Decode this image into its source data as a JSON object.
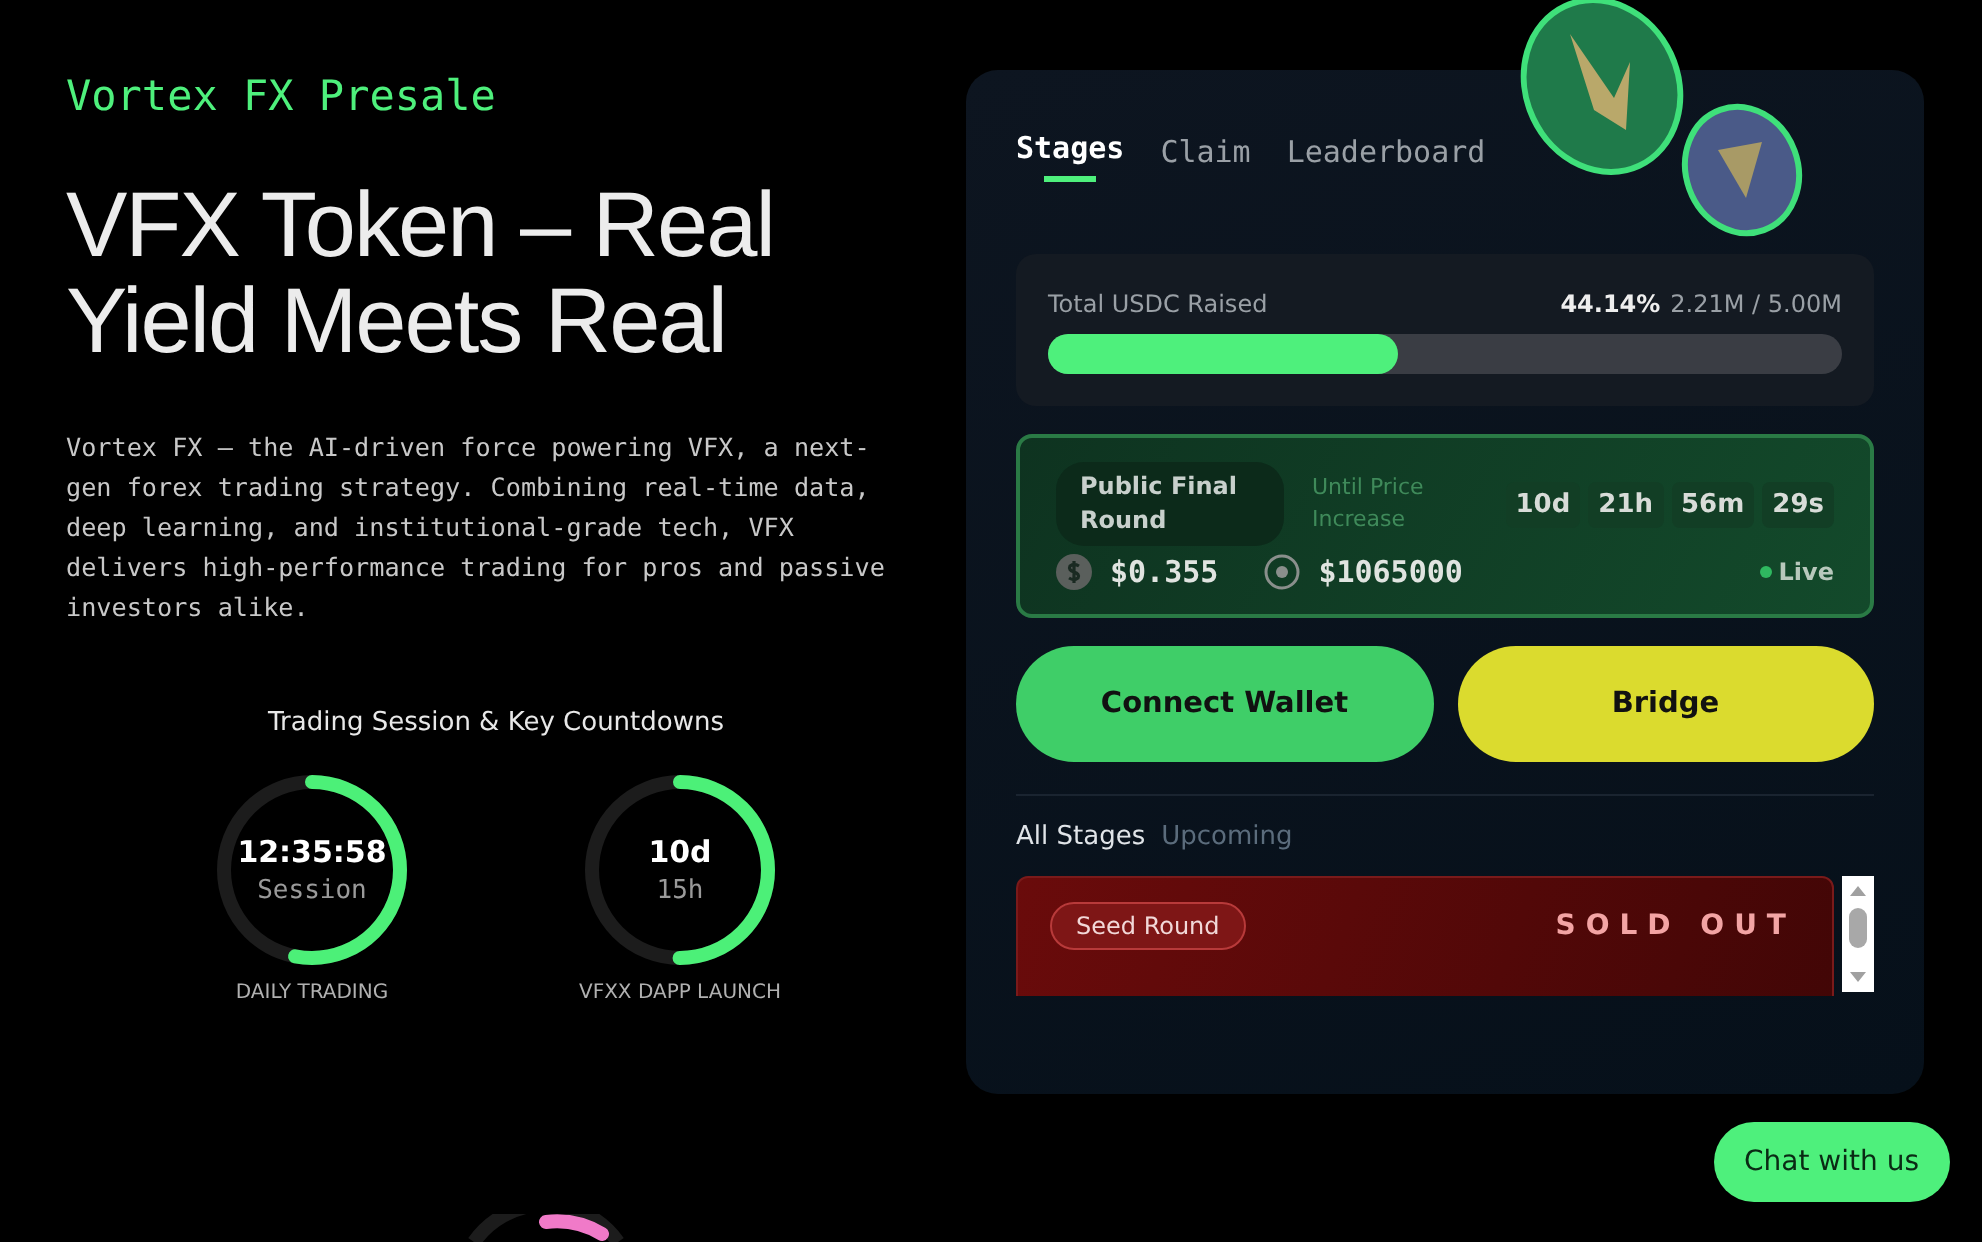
{
  "eyebrow": "Vortex FX Presale",
  "headline": "VFX Token – Real Yield Meets Real",
  "intro": "Vortex FX — the AI-driven force powering VFX, a next-gen forex trading strategy. Combining real-time data, deep learning, and institutional-grade tech, VFX delivers high-performance trading for pros and passive investors alike.",
  "countdowns": {
    "title": "Trading Session & Key Countdowns",
    "items": [
      {
        "value": "12:35:58",
        "sub": "Session",
        "caption": "DAILY TRADING",
        "level": 0.53
      },
      {
        "value": "10d",
        "sub": "15h",
        "caption": "VFXX DAPP LAUNCH",
        "level": 0.5
      }
    ]
  },
  "presale": {
    "tabs": [
      {
        "label": "Stages",
        "selected": true
      },
      {
        "label": "Claim",
        "selected": false
      },
      {
        "label": "Leaderboard",
        "selected": false
      }
    ],
    "raised": {
      "label": "Total USDC Raised",
      "percent": "44.14%",
      "amount": "2.21M / 5.00M",
      "level": 0.4414
    },
    "stage": {
      "name": "Public Final Round",
      "until": "Until Price Increase",
      "timer": [
        "10d",
        "21h",
        "56m",
        "29s"
      ],
      "price": "$0.355",
      "target": "$1065000",
      "status": "Live",
      "live": true
    },
    "buttons": [
      {
        "label": "Connect Wallet",
        "kind": "primary"
      },
      {
        "label": "Bridge",
        "kind": "secondary"
      }
    ],
    "filters": [
      {
        "label": "All Stages",
        "selected": true
      },
      {
        "label": "Upcoming",
        "selected": false
      }
    ],
    "stages": [
      {
        "name": "Seed Round",
        "status": "SOLD OUT"
      }
    ]
  },
  "chat_button": "Chat with us"
}
